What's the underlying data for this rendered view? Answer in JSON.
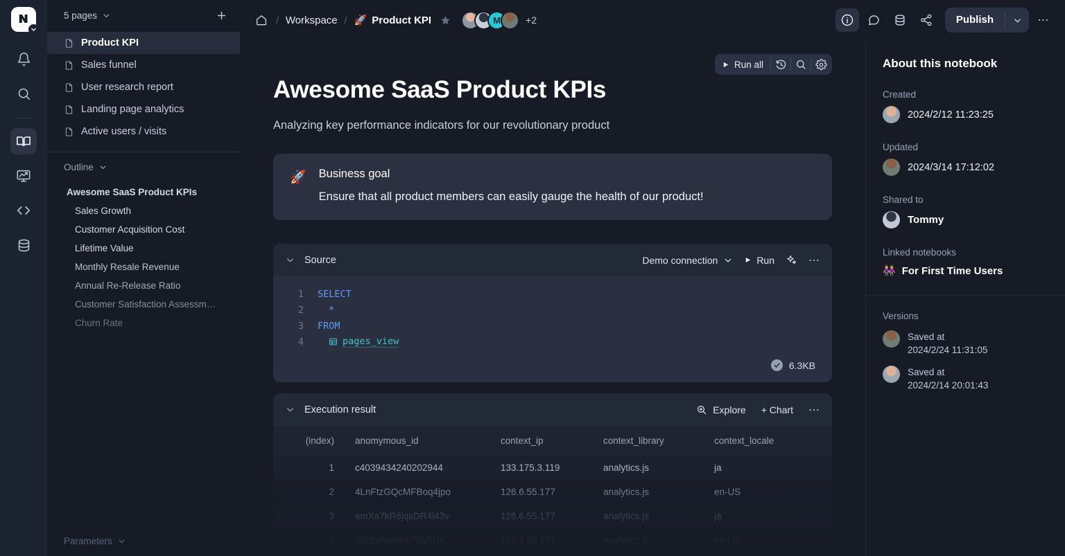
{
  "rail": {
    "logo_glyph": "и",
    "items": [
      {
        "name": "notifications-icon",
        "label": "Notifications"
      },
      {
        "name": "search-icon",
        "label": "Search"
      },
      {
        "name": "notebook-icon",
        "label": "Notebooks"
      },
      {
        "name": "dashboard-icon",
        "label": "Dashboards"
      },
      {
        "name": "code-icon",
        "label": "Code"
      },
      {
        "name": "database-icon",
        "label": "Data sources"
      }
    ]
  },
  "panel": {
    "pages_title": "5 pages",
    "add_label": "+",
    "pages": [
      {
        "label": "Product KPI",
        "active": true
      },
      {
        "label": "Sales funnel",
        "active": false
      },
      {
        "label": "User research report",
        "active": false
      },
      {
        "label": "Landing page analytics",
        "active": false
      },
      {
        "label": "Active users / visits",
        "active": false
      }
    ],
    "outline_title": "Outline",
    "outline": [
      {
        "label": "Awesome SaaS Product KPIs",
        "level": 0
      },
      {
        "label": "Sales Growth",
        "level": 1
      },
      {
        "label": "Customer Acquisition Cost",
        "level": 1
      },
      {
        "label": "Lifetime Value",
        "level": 1
      },
      {
        "label": "Monthly Resale Revenue",
        "level": 1
      },
      {
        "label": "Annual Re-Release Ratio",
        "level": 1
      },
      {
        "label": "Customer Satisfaction Assessm…",
        "level": 1
      },
      {
        "label": "Churn Rate",
        "level": 1
      }
    ],
    "parameters_title": "Parameters"
  },
  "topbar": {
    "home_label": "Home",
    "sep": "/",
    "workspace": "Workspace",
    "page_emoji": "🚀",
    "page_title": "Product KPI",
    "avatars": [
      {
        "type": "photo",
        "name": "avatar-1"
      },
      {
        "type": "photo",
        "name": "avatar-2"
      },
      {
        "type": "initial",
        "initial": "M",
        "name": "avatar-3"
      },
      {
        "type": "photo",
        "name": "avatar-4"
      }
    ],
    "avatar_overflow": "+2",
    "publish_label": "Publish",
    "more_label": "⋯"
  },
  "toolbar": {
    "run_all_label": "Run all",
    "history_name": "history-icon",
    "search_name": "search-icon",
    "settings_name": "gear-icon"
  },
  "doc": {
    "title": "Awesome SaaS Product KPIs",
    "subtitle": "Analyzing key performance indicators for our revolutionary product",
    "callout": {
      "emoji": "🚀",
      "title": "Business goal",
      "body": "Ensure that all product members can easily gauge the health of our product!"
    }
  },
  "source_cell": {
    "title": "Source",
    "connection": "Demo connection",
    "run_label": "Run",
    "more_label": "⋯",
    "code_lines": [
      {
        "n": "1",
        "indent": 0,
        "kind": "kw",
        "text": "SELECT"
      },
      {
        "n": "2",
        "indent": 1,
        "kind": "op",
        "text": "*"
      },
      {
        "n": "3",
        "indent": 0,
        "kind": "kw",
        "text": "FROM"
      },
      {
        "n": "4",
        "indent": 1,
        "kind": "table",
        "text": "pages_view"
      }
    ],
    "size_label": "6.3KB"
  },
  "result_cell": {
    "title": "Execution result",
    "explore_label": "Explore",
    "chart_label": "+ Chart",
    "more_label": "⋯",
    "columns": [
      "(index)",
      "anomymous_id",
      "context_ip",
      "context_library",
      "context_locale"
    ],
    "rows": [
      [
        "1",
        "c4039434240202944",
        "133.175.3.119",
        "analytics.js",
        "ja"
      ],
      [
        "2",
        "4LnFtzGQcMFBoq4jpo",
        "126.6.55.177",
        "analytics.js",
        "en-US"
      ],
      [
        "3",
        "emXa7kR6jqsDR4i43v",
        "126.6.55.177",
        "analytics.js",
        "ja"
      ],
      [
        "4",
        "6W6xfhmfAoFYbRUK",
        "126.6.55.177",
        "analytics.js",
        "en-US"
      ]
    ]
  },
  "about": {
    "title": "About this notebook",
    "created_label": "Created",
    "created_value": "2024/2/12 11:23:25",
    "updated_label": "Updated",
    "updated_value": "2024/3/14 17:12:02",
    "shared_label": "Shared to",
    "shared_user": "Tommy",
    "linked_label": "Linked notebooks",
    "linked_emoji": "👭",
    "linked_notebook": "For First Time Users",
    "versions_label": "Versions",
    "versions": [
      {
        "prefix": "Saved at",
        "value": "2024/2/24 11:31:05"
      },
      {
        "prefix": "Saved at",
        "value": "2024/2/14 20:01:43"
      }
    ]
  },
  "colors": {
    "app_bg": "#12161f",
    "panel_bg": "#161b26",
    "rail_bg": "#1b2230",
    "cell_bg": "#2a3040",
    "accent_keyword": "#5b9cf6",
    "accent_table": "#3fc2c9",
    "avatar_initial_bg": "#27c8d8"
  }
}
